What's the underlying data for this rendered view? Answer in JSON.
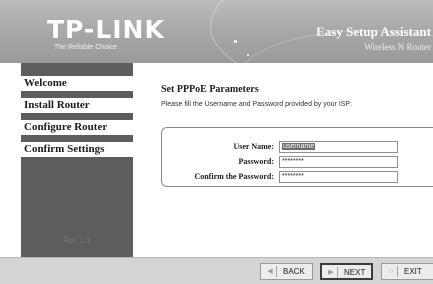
{
  "header": {
    "logo": "TP-LINK",
    "tagline": "The Reliable Choice",
    "title": "Easy Setup Assistant",
    "subtitle": "Wireless N Router"
  },
  "sidebar": {
    "items": [
      {
        "label": "Welcome"
      },
      {
        "label": "Install Router"
      },
      {
        "label": "Configure Router"
      },
      {
        "label": "Confirm Settings"
      }
    ],
    "revision": "Rev 1.1"
  },
  "main": {
    "title": "Set PPPoE Parameters",
    "description": "Please fill the Username and Password provided by your ISP:",
    "fields": {
      "username": {
        "label": "User Name:",
        "value": "username"
      },
      "password": {
        "label": "Password:",
        "value": "********"
      },
      "confirm": {
        "label": "Confirm the Password:",
        "value": "********"
      }
    }
  },
  "footer": {
    "back": "BACK",
    "next": "NEXT",
    "exit": "EXIT"
  },
  "colors": {
    "header": "#a9a9a9",
    "sidebar": "#5d5d5d",
    "footer": "#d4d4d4"
  },
  "icons": [
    "back-arrow-icon",
    "next-arrow-icon",
    "exit-icon"
  ]
}
